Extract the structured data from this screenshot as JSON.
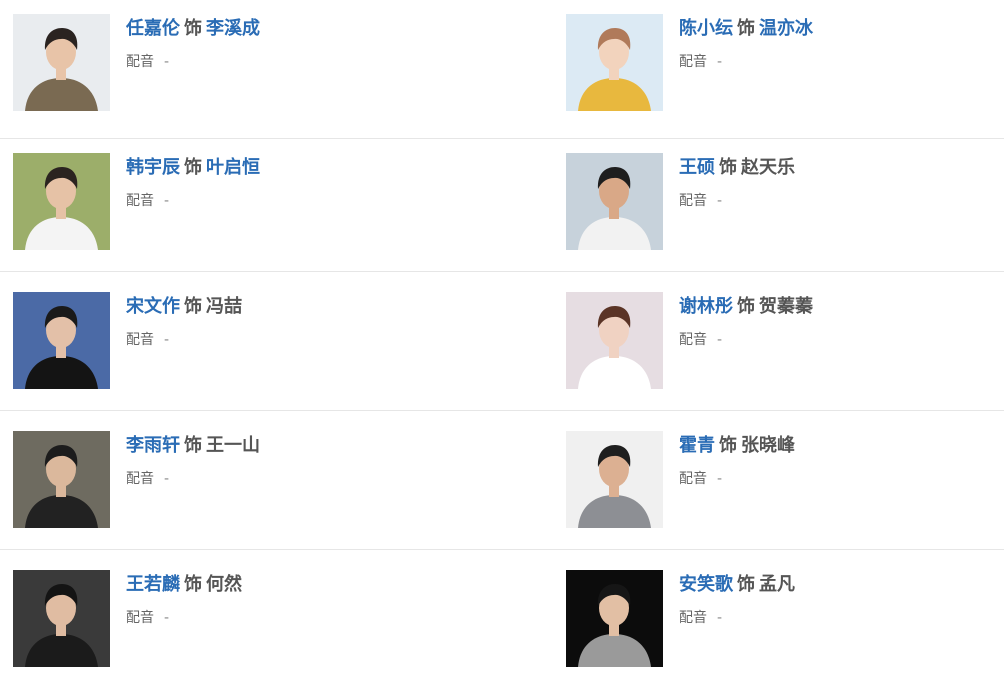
{
  "cast": [
    {
      "actor": "任嘉伦",
      "sep": "饰",
      "role": "李溪成",
      "role_linked": true,
      "voice_label": "配音",
      "voice_value": "-",
      "photo": {
        "bg": "#e9ecef",
        "skin": "#e8c4a8",
        "hair": "#2a2320",
        "shirt": "#7a6a52"
      }
    },
    {
      "actor": "陈小纭",
      "sep": "饰",
      "role": "温亦冰",
      "role_linked": true,
      "voice_label": "配音",
      "voice_value": "-",
      "photo": {
        "bg": "#dceaf4",
        "skin": "#f2d3bd",
        "hair": "#b07a5a",
        "shirt": "#e8b83e"
      }
    },
    {
      "actor": "韩宇辰",
      "sep": "饰",
      "role": "叶启恒",
      "role_linked": true,
      "voice_label": "配音",
      "voice_value": "-",
      "photo": {
        "bg": "#9cae6a",
        "skin": "#e6c2a6",
        "hair": "#2b2420",
        "shirt": "#f4f4f4"
      }
    },
    {
      "actor": "王硕",
      "sep": "饰",
      "role": "赵天乐",
      "role_linked": false,
      "voice_label": "配音",
      "voice_value": "-",
      "photo": {
        "bg": "#c7d2db",
        "skin": "#d9a887",
        "hair": "#1e1e1e",
        "shirt": "#f2f2f2"
      }
    },
    {
      "actor": "宋文作",
      "sep": "饰",
      "role": "冯喆",
      "role_linked": false,
      "voice_label": "配音",
      "voice_value": "-",
      "photo": {
        "bg": "#4b6aa6",
        "skin": "#e3c0a8",
        "hair": "#1a1a1a",
        "shirt": "#141414"
      }
    },
    {
      "actor": "谢林彤",
      "sep": "饰",
      "role": "贺蓁蓁",
      "role_linked": false,
      "voice_label": "配音",
      "voice_value": "-",
      "photo": {
        "bg": "#e6dde2",
        "skin": "#f0d2c2",
        "hair": "#5b3426",
        "shirt": "#ffffff"
      }
    },
    {
      "actor": "李雨轩",
      "sep": "饰",
      "role": "王一山",
      "role_linked": false,
      "voice_label": "配音",
      "voice_value": "-",
      "photo": {
        "bg": "#6e6b60",
        "skin": "#dbb89c",
        "hair": "#1c1c1c",
        "shirt": "#222222"
      }
    },
    {
      "actor": "霍青",
      "sep": "饰",
      "role": "张晓峰",
      "role_linked": false,
      "voice_label": "配音",
      "voice_value": "-",
      "photo": {
        "bg": "#f0f0f0",
        "skin": "#dcb092",
        "hair": "#1f1f1f",
        "shirt": "#8d8f94"
      }
    },
    {
      "actor": "王若麟",
      "sep": "饰",
      "role": "何然",
      "role_linked": false,
      "voice_label": "配音",
      "voice_value": "-",
      "photo": {
        "bg": "#3a3a3a",
        "skin": "#e0bca2",
        "hair": "#141414",
        "shirt": "#1b1b1b"
      }
    },
    {
      "actor": "安笑歌",
      "sep": "饰",
      "role": "孟凡",
      "role_linked": false,
      "voice_label": "配音",
      "voice_value": "-",
      "photo": {
        "bg": "#0c0c0c",
        "skin": "#e2bfa4",
        "hair": "#161616",
        "shirt": "#9a9a9a"
      }
    }
  ]
}
